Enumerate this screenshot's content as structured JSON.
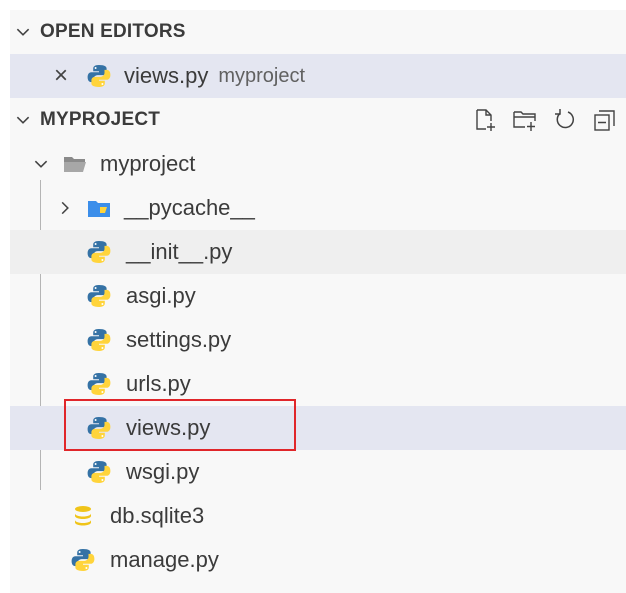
{
  "open_editors": {
    "header": "OPEN EDITORS",
    "item": {
      "label": "views.py",
      "description": "myproject",
      "close_glyph": "×"
    }
  },
  "explorer": {
    "header": "MYPROJECT",
    "actions": [
      "new-file-icon",
      "new-folder-icon",
      "refresh-icon",
      "collapse-all-icon"
    ],
    "folder": {
      "label": "myproject",
      "expanded": true
    },
    "folder_children": [
      {
        "label": "__pycache__",
        "type": "folder",
        "expanded": false
      },
      {
        "label": "__init__.py",
        "type": "python"
      },
      {
        "label": "asgi.py",
        "type": "python"
      },
      {
        "label": "settings.py",
        "type": "python"
      },
      {
        "label": "urls.py",
        "type": "python"
      },
      {
        "label": "views.py",
        "type": "python",
        "selected": true,
        "highlighted": true
      },
      {
        "label": "wsgi.py",
        "type": "python"
      }
    ],
    "root_files": [
      {
        "label": "db.sqlite3",
        "type": "database"
      },
      {
        "label": "manage.py",
        "type": "python"
      }
    ]
  },
  "colors": {
    "selection": "#e4e6f1",
    "highlight_border": "#e0262a",
    "python_blue": "#3572a5",
    "python_yellow": "#ffd43b",
    "db_yellow": "#f0c419",
    "folder_gray": "#9e9e9e",
    "pycache_blue": "#3b8eea"
  }
}
